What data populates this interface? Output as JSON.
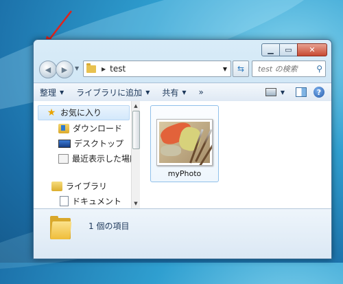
{
  "window": {
    "caption": {
      "minimize": "▁",
      "maximize": "▭",
      "close": "✕"
    }
  },
  "nav": {
    "back_glyph": "◀",
    "forward_glyph": "▶",
    "path": "test",
    "search_placeholder": "test の検索"
  },
  "toolbar": {
    "organize": "整理",
    "include_library": "ライブラリに追加",
    "share": "共有",
    "more": "»",
    "help": "?"
  },
  "navpane": {
    "favorites": "お気に入り",
    "items": [
      "ダウンロード",
      "デスクトップ",
      "最近表示した場所"
    ],
    "libraries": "ライブラリ",
    "library_items": [
      "ドキュメント"
    ]
  },
  "content": {
    "files": [
      {
        "name": "myPhoto",
        "type": "image"
      }
    ]
  },
  "details": {
    "count_text": "1 個の項目"
  },
  "colors": {
    "arrow": "#e0231c",
    "accent": "#3d6e95"
  }
}
